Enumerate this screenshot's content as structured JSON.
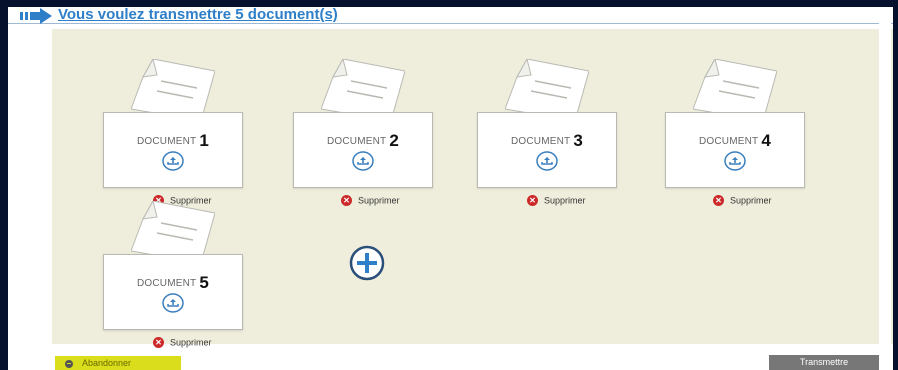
{
  "header": {
    "title": "Vous voulez transmettre 5 document(s)"
  },
  "documents": [
    {
      "prefix": "DOCUMENT",
      "number": "1",
      "delete_label": "Supprimer"
    },
    {
      "prefix": "DOCUMENT",
      "number": "2",
      "delete_label": "Supprimer"
    },
    {
      "prefix": "DOCUMENT",
      "number": "3",
      "delete_label": "Supprimer"
    },
    {
      "prefix": "DOCUMENT",
      "number": "4",
      "delete_label": "Supprimer"
    },
    {
      "prefix": "DOCUMENT",
      "number": "5",
      "delete_label": "Supprimer"
    }
  ],
  "footer": {
    "abandon_label": "Abandonner",
    "transmit_label": "Transmettre"
  },
  "colors": {
    "accent_blue": "#2e7fc8",
    "drop_zone": "#efeedc",
    "delete_red": "#cc2a2a",
    "abandon_yellow": "#d9dd1c",
    "transmit_gray": "#777777"
  },
  "icons": {
    "arrow": "arrow-right-icon",
    "upload": "upload-icon",
    "delete": "close-circle-icon",
    "add": "plus-circle-icon"
  }
}
